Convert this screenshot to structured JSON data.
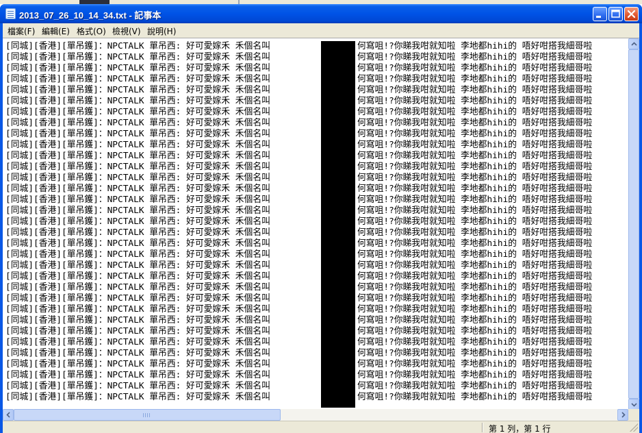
{
  "window": {
    "title": "2013_07_26_10_14_34.txt - 記事本"
  },
  "menu": [
    {
      "label": "檔案(F)"
    },
    {
      "label": "編輯(E)"
    },
    {
      "label": "格式(O)"
    },
    {
      "label": "檢視(V)"
    },
    {
      "label": "說明(H)"
    }
  ],
  "document": {
    "line_left": "[同城][香港][單吊鑊]：NPCTALK 單吊西: 好可愛嫁禾 禾個名叫",
    "line_right": "何寫咀!?你睇我咁就知啦 李地都hihi的 唔好咁搭我細哥啦",
    "visible_line_count": 33,
    "redacted": true
  },
  "status": {
    "position": "第 1 列，第 1 行"
  },
  "colors": {
    "title_bar": "#0053e6",
    "menu_bg": "#ece9d8",
    "close_button": "#e25a33",
    "redaction": "#000000"
  },
  "icons": [
    "notepad-icon",
    "minimize-icon",
    "maximize-icon",
    "close-icon",
    "scroll-up-icon",
    "scroll-down-icon",
    "scroll-left-icon",
    "scroll-right-icon"
  ]
}
